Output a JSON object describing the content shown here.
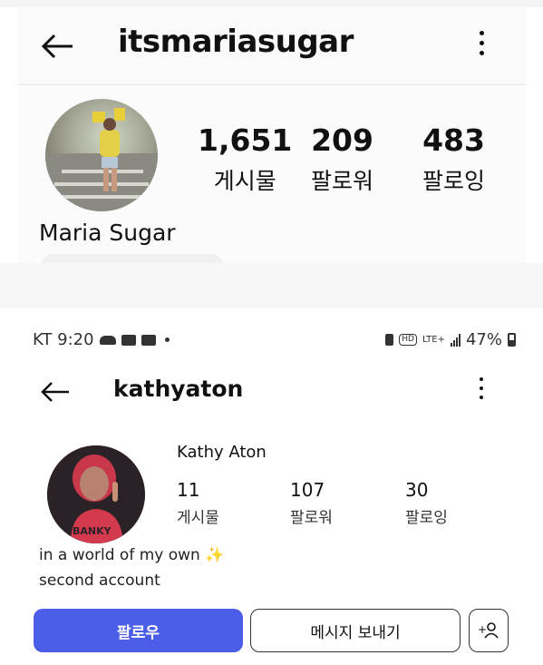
{
  "profile_top": {
    "username": "itsmariasugar",
    "display_name": "Maria Sugar",
    "stats": [
      {
        "value": "1,651",
        "label": "게시물"
      },
      {
        "value": "209",
        "label": "팔로워"
      },
      {
        "value": "483",
        "label": "팔로잉"
      }
    ]
  },
  "status_bar": {
    "carrier_time": "KT 9:20",
    "hd": "HD",
    "network": "LTE+",
    "battery": "47%"
  },
  "profile_bottom": {
    "username": "kathyaton",
    "display_name": "Kathy Aton",
    "stats": [
      {
        "value": "11",
        "label": "게시물"
      },
      {
        "value": "107",
        "label": "팔로워"
      },
      {
        "value": "30",
        "label": "팔로잉"
      }
    ],
    "bio_line1": "in a world of my own",
    "bio_sparkle": "✨",
    "bio_line2": "second account",
    "follow_label": "팔로우",
    "message_label": "메시지 보내기",
    "add_person_label": "+♀"
  },
  "icons": {
    "back": "arrow-left-icon",
    "more": "more-vertical-icon",
    "add_person": "add-person-icon"
  },
  "colors": {
    "follow_button": "#4c5ee8"
  }
}
